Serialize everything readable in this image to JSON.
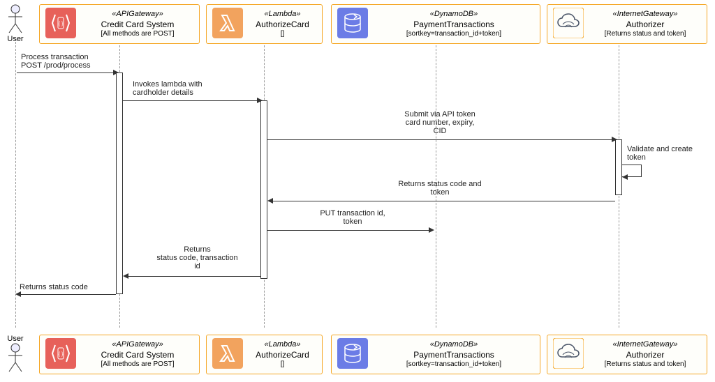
{
  "actors": {
    "user_top": "User",
    "user_bottom": "User"
  },
  "participants": {
    "api": {
      "stereo": "«APIGateway»",
      "title": "Credit Card System",
      "meta": "[All methods are POST]"
    },
    "lambda": {
      "stereo": "«Lambda»",
      "title": "AuthorizeCard",
      "meta": "[]"
    },
    "dynamo": {
      "stereo": "«DynamoDB»",
      "title": "PaymentTransactions",
      "meta": "[sortkey=transaction_id+token]"
    },
    "igw": {
      "stereo": "«InternetGateway»",
      "title": "Authorizer",
      "meta": "[Returns status and token]"
    }
  },
  "messages": {
    "m1a": "Process transaction",
    "m1b": "POST /prod/process",
    "m2a": "Invokes lambda with",
    "m2b": "cardholder details",
    "m3a": "Submit via API token",
    "m3b": "card number, expiry,",
    "m3c": "CID",
    "m4a": "Validate and create",
    "m4b": "token",
    "m5a": "Returns status code and",
    "m5b": "token",
    "m6a": "PUT transaction id,",
    "m6b": "token",
    "m7a": "Returns",
    "m7b": "status code, transaction",
    "m7c": "id",
    "m8": "Returns status code"
  },
  "chart_data": {
    "type": "sequence_diagram",
    "participants": [
      {
        "id": "user",
        "type": "actor",
        "name": "User"
      },
      {
        "id": "api",
        "type": "participant",
        "stereotype": "APIGateway",
        "name": "Credit Card System",
        "note": "All methods are POST"
      },
      {
        "id": "lambda",
        "type": "participant",
        "stereotype": "Lambda",
        "name": "AuthorizeCard",
        "note": ""
      },
      {
        "id": "dynamo",
        "type": "participant",
        "stereotype": "DynamoDB",
        "name": "PaymentTransactions",
        "note": "sortkey=transaction_id+token"
      },
      {
        "id": "igw",
        "type": "participant",
        "stereotype": "InternetGateway",
        "name": "Authorizer",
        "note": "Returns status and token"
      }
    ],
    "messages": [
      {
        "from": "user",
        "to": "api",
        "label": "Process transaction POST /prod/process",
        "dir": "request"
      },
      {
        "from": "api",
        "to": "lambda",
        "label": "Invokes lambda with cardholder details",
        "dir": "request"
      },
      {
        "from": "lambda",
        "to": "igw",
        "label": "Submit via API token card number, expiry, CID",
        "dir": "request"
      },
      {
        "from": "igw",
        "to": "igw",
        "label": "Validate and create token",
        "dir": "self"
      },
      {
        "from": "igw",
        "to": "lambda",
        "label": "Returns status code and token",
        "dir": "response"
      },
      {
        "from": "lambda",
        "to": "dynamo",
        "label": "PUT transaction id, token",
        "dir": "request"
      },
      {
        "from": "lambda",
        "to": "api",
        "label": "Returns status code, transaction id",
        "dir": "response"
      },
      {
        "from": "api",
        "to": "user",
        "label": "Returns status code",
        "dir": "response"
      }
    ]
  }
}
